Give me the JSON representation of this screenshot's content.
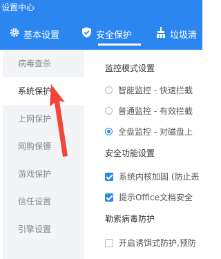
{
  "window": {
    "title": "设置中心"
  },
  "tabs": [
    {
      "label": "基本设置",
      "icon": "gear-icon"
    },
    {
      "label": "安全保护",
      "icon": "shield-check-icon",
      "active": true
    },
    {
      "label": "垃圾清",
      "icon": "broom-icon"
    }
  ],
  "sidebar": {
    "items": [
      {
        "label": "病毒查杀"
      },
      {
        "label": "系统保护",
        "active": true
      },
      {
        "label": "上网保护"
      },
      {
        "label": "网购保镖"
      },
      {
        "label": "游戏保护"
      },
      {
        "label": "信任设置"
      },
      {
        "label": "引擎设置"
      }
    ]
  },
  "sections": {
    "monitor": {
      "title": "监控模式设置",
      "options": [
        {
          "label": "智能监控 - 快速拦截",
          "selected": false
        },
        {
          "label": "普通监控 - 有效拦截",
          "selected": false
        },
        {
          "label": "全盘监控 - 对磁盘上",
          "selected": true
        }
      ]
    },
    "security": {
      "title": "安全功能设置",
      "options": [
        {
          "label": "系统内核加固 (防止恶",
          "checked": true
        },
        {
          "label": "提示Office文档安全",
          "checked": true
        }
      ]
    },
    "ransom": {
      "title": "勒索病毒防护",
      "options": [
        {
          "label": "开启诱饵式防护,预防",
          "checked": false
        }
      ]
    }
  },
  "colors": {
    "accent": "#2b86f0",
    "arrow": "#f0473a",
    "sidebar_bg": "#f2f4f8"
  }
}
